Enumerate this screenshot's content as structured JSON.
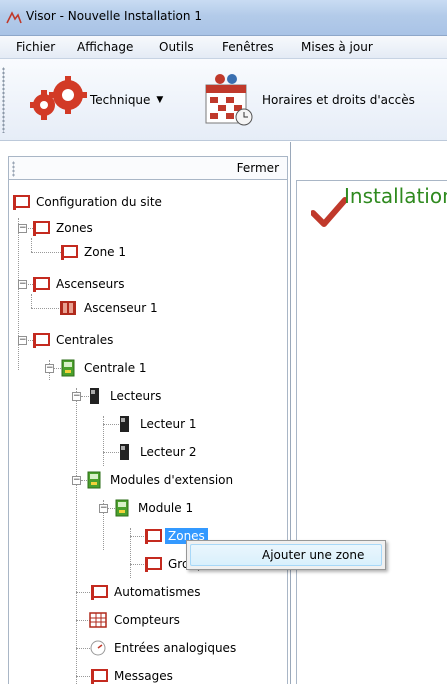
{
  "window": {
    "title": "Visor - Nouvelle Installation 1"
  },
  "menu": [
    "Fichier",
    "Affichage",
    "Outils",
    "Fenêtres",
    "Mises à jour"
  ],
  "toolbar": {
    "technique_label": "Technique",
    "horaires_label": "Horaires et droits d'accès"
  },
  "panel": {
    "close_label": "Fermer"
  },
  "tree": [
    {
      "label": "Configuration du site"
    },
    {
      "label": "Zones"
    },
    {
      "label": "Zone 1"
    },
    {
      "label": "Ascenseurs"
    },
    {
      "label": "Ascenseur 1"
    },
    {
      "label": "Centrales"
    },
    {
      "label": "Centrale 1"
    },
    {
      "label": "Lecteurs"
    },
    {
      "label": "Lecteur 1"
    },
    {
      "label": "Lecteur 2"
    },
    {
      "label": "Modules d'extension"
    },
    {
      "label": "Module 1"
    },
    {
      "label": "Zones"
    },
    {
      "label": "Groupes"
    },
    {
      "label": "Automatismes"
    },
    {
      "label": "Compteurs"
    },
    {
      "label": "Entrées analogiques"
    },
    {
      "label": "Messages"
    }
  ],
  "main": {
    "status_text": "Installation"
  },
  "context_menu": {
    "item_label": "Ajouter une zone"
  }
}
